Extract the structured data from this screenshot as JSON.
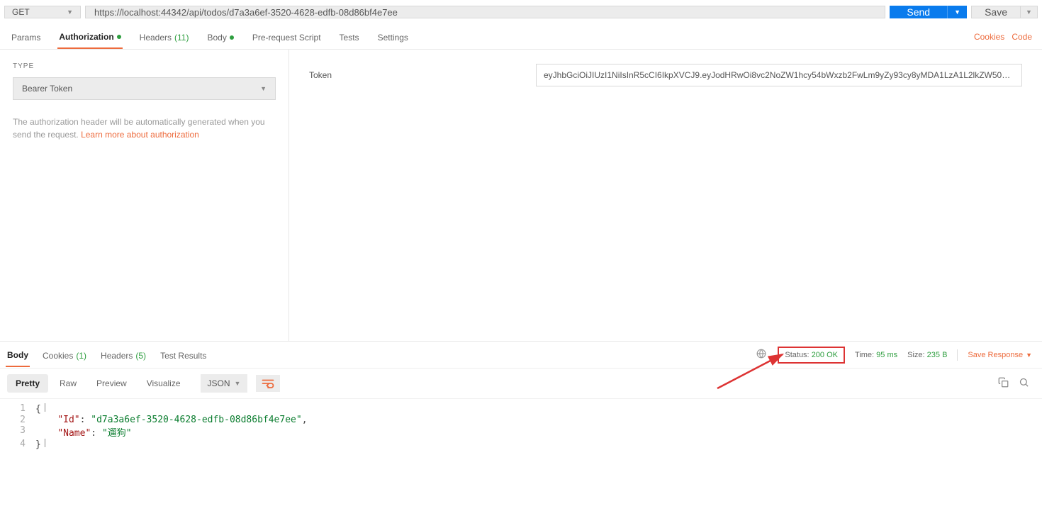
{
  "request": {
    "method": "GET",
    "url": "https://localhost:44342/api/todos/d7a3a6ef-3520-4628-edfb-08d86bf4e7ee",
    "send_label": "Send",
    "save_label": "Save"
  },
  "tabs": {
    "params": "Params",
    "authorization": "Authorization",
    "headers": "Headers",
    "headers_count": "(11)",
    "body": "Body",
    "prerequest": "Pre-request Script",
    "tests": "Tests",
    "settings": "Settings",
    "cookies_link": "Cookies",
    "code_link": "Code"
  },
  "auth": {
    "type_label": "TYPE",
    "type_value": "Bearer Token",
    "desc_pre": "The authorization header will be automatically generated when you send the request. ",
    "learn_more": "Learn more about authorization",
    "token_label": "Token",
    "token_value": "eyJhbGciOiJIUzI1NiIsInR5cCI6IkpXVCJ9.eyJodHRwOi8vc2NoZW1hcy54bWxzb2FwLm9yZy93cy8yMDA1LzA1L2lkZW50aXR5L ..."
  },
  "response_tabs": {
    "body": "Body",
    "cookies": "Cookies",
    "cookies_count": "(1)",
    "headers": "Headers",
    "headers_count": "(5)",
    "test_results": "Test Results"
  },
  "response_meta": {
    "status_label": "Status:",
    "status_value": "200 OK",
    "time_label": "Time:",
    "time_value": "95 ms",
    "size_label": "Size:",
    "size_value": "235 B",
    "save_response": "Save Response"
  },
  "body_toolbar": {
    "pretty": "Pretty",
    "raw": "Raw",
    "preview": "Preview",
    "visualize": "Visualize",
    "format": "JSON"
  },
  "body_json": {
    "line1": "{",
    "line2_key": "\"Id\"",
    "line2_val": "\"d7a3a6ef-3520-4628-edfb-08d86bf4e7ee\"",
    "line3_key": "\"Name\"",
    "line3_val": "\"遛狗\"",
    "line4": "}"
  }
}
